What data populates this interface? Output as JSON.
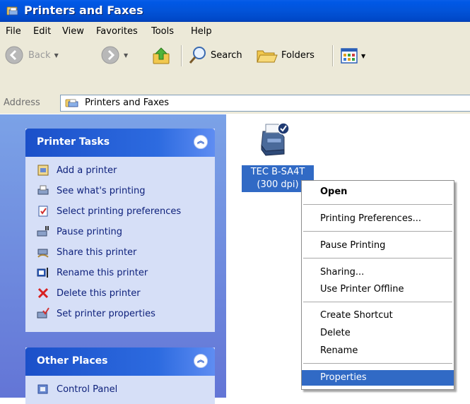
{
  "window": {
    "title": "Printers and Faxes"
  },
  "menu": [
    "File",
    "Edit",
    "View",
    "Favorites",
    "Tools",
    "Help"
  ],
  "toolbar": {
    "back": "Back",
    "search": "Search",
    "folders": "Folders"
  },
  "address": {
    "label": "Address",
    "value": "Printers and Faxes"
  },
  "printer_tasks": {
    "title": "Printer Tasks",
    "items": [
      "Add a printer",
      "See what's printing",
      "Select printing preferences",
      "Pause printing",
      "Share this printer",
      "Rename this printer",
      "Delete this printer",
      "Set printer properties"
    ]
  },
  "other_places": {
    "title": "Other Places",
    "items": [
      "Control Panel"
    ]
  },
  "printer": {
    "name_line1": "TEC B-SA4T",
    "name_line2": "(300 dpi)"
  },
  "context_menu": [
    "Open",
    "Printing Preferences...",
    "Pause Printing",
    "Sharing...",
    "Use Printer Offline",
    "Create Shortcut",
    "Delete",
    "Rename",
    "Properties"
  ],
  "colors": {
    "title_bar": "#0054e3",
    "selection": "#316ac5",
    "task_pane": "#6f8fe0",
    "panel_body": "#d6dff7"
  }
}
